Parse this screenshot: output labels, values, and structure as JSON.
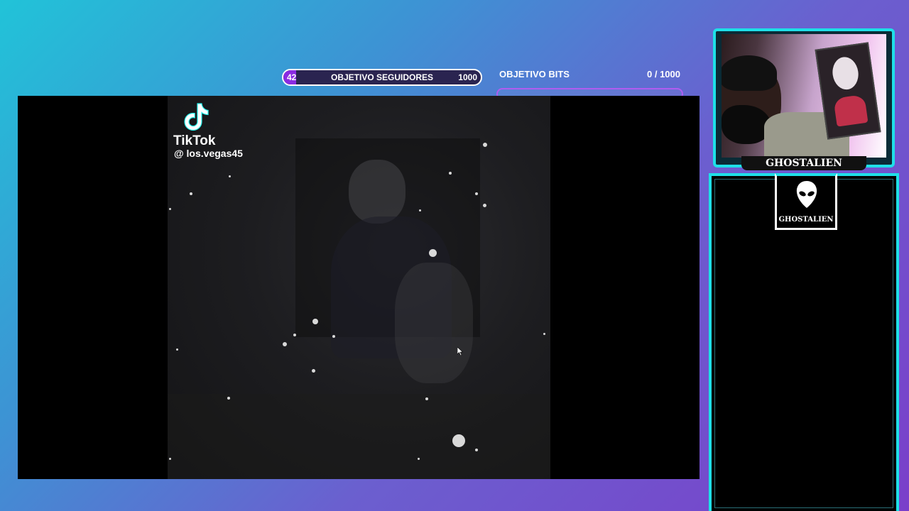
{
  "follower_goal": {
    "current": "42",
    "title": "OBJETIVO SEGUIDORES",
    "max": "1000",
    "progress_fraction": 0.042,
    "fill_color": "#8a2be2"
  },
  "bits_goal": {
    "title": "OBJETIVO BITS",
    "count": "0 / 1000",
    "progress_fraction": 0,
    "bar_color": "#b05cf0"
  },
  "video": {
    "watermark_brand": "TikTok",
    "watermark_handle": "@ los.vegas45",
    "logo_icon": "tiktok-logo-icon"
  },
  "webcam": {
    "name": "GHOSTALIEN"
  },
  "chat_badge": {
    "label": "GHOSTALIEN",
    "icon": "alien-head-icon"
  },
  "colors": {
    "accent_cyan": "#1ee0e8",
    "accent_purple": "#b05cf0",
    "background_gradient_start": "#21c3d8",
    "background_gradient_end": "#7a3fca"
  }
}
